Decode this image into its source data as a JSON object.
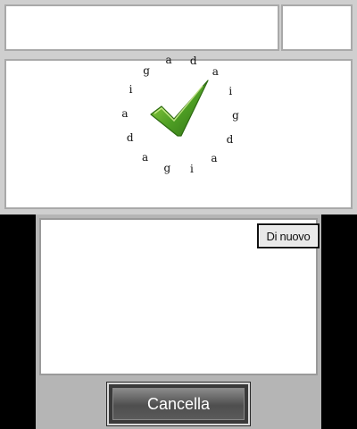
{
  "top_screen": {
    "status_left": "",
    "status_right": "",
    "ring_letters": [
      "a",
      "d",
      "a",
      "i",
      "g",
      "d",
      "a",
      "i",
      "g",
      "a",
      "d",
      "a",
      "i",
      "g"
    ],
    "check_icon": "checkmark-icon",
    "accent_color": "#5aa52a"
  },
  "bottom_screen": {
    "retry_label": "Di nuovo",
    "cancel_label": "Cancella"
  }
}
